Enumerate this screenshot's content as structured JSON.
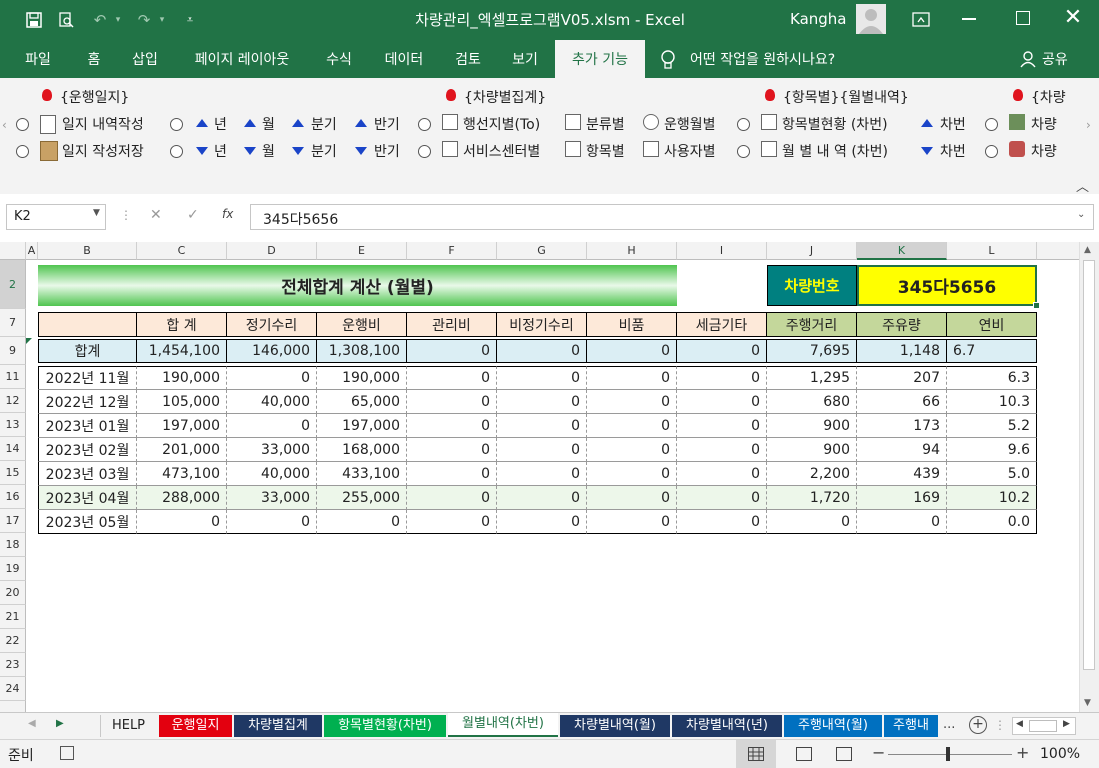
{
  "window": {
    "title": "차량관리_엑셀프로그램V05.xlsm  -  Excel",
    "user": "Kangha"
  },
  "ribbon_tabs": [
    "파일",
    "홈",
    "삽입",
    "페이지 레이아웃",
    "수식",
    "데이터",
    "검토",
    "보기",
    "추가 기능"
  ],
  "tell_me": "어떤 작업을 원하시나요?",
  "share_label": "공유",
  "ribbon": {
    "group1": {
      "title": "{운행일지}",
      "item1": "일지 내역작성",
      "item2": "일지 작성저장"
    },
    "period": {
      "year": "년",
      "month": "월",
      "quarter": "분기",
      "half": "반기"
    },
    "group2": {
      "title": "{차량별집계}",
      "a1": "행선지별(To)",
      "a2": "분류별",
      "a3": "운행월별",
      "b1": "서비스센터별",
      "b2": "항목별",
      "b3": "사용자별"
    },
    "group3": {
      "title": "{항목별}{월별내역}",
      "a1": "항목별현황 (차번)",
      "a2": "차번",
      "b1": "월 별 내 역 (차번)",
      "b2": "차번"
    },
    "group4": {
      "title": "{차량",
      "a1": "차량",
      "b1": "차량"
    }
  },
  "formula_bar": {
    "name_box": "K2",
    "fx": "fx",
    "value": "345다5656"
  },
  "columns": [
    "A",
    "B",
    "C",
    "D",
    "E",
    "F",
    "G",
    "H",
    "I",
    "J",
    "K",
    "L"
  ],
  "rows": [
    "2",
    "7",
    "9",
    "11",
    "12",
    "13",
    "14",
    "15",
    "16",
    "17",
    "18",
    "19",
    "20",
    "21",
    "22",
    "23",
    "24"
  ],
  "sheet": {
    "title": "전체합계 계산 (월별)",
    "vehicle_label": "차량번호",
    "vehicle_value": "345다5656",
    "headers": [
      "",
      "합  계",
      "정기수리",
      "운행비",
      "관리비",
      "비정기수리",
      "비품",
      "세금기타",
      "주행거리",
      "주유량",
      "연비"
    ],
    "total": [
      "합계",
      "1,454,100",
      "146,000",
      "1,308,100",
      "0",
      "0",
      "0",
      "0",
      "7,695",
      "1,148",
      "6.7"
    ],
    "data": [
      [
        "2022년 11월",
        "190,000",
        "0",
        "190,000",
        "0",
        "0",
        "0",
        "0",
        "1,295",
        "207",
        "6.3"
      ],
      [
        "2022년 12월",
        "105,000",
        "40,000",
        "65,000",
        "0",
        "0",
        "0",
        "0",
        "680",
        "66",
        "10.3"
      ],
      [
        "2023년 01월",
        "197,000",
        "0",
        "197,000",
        "0",
        "0",
        "0",
        "0",
        "900",
        "173",
        "5.2"
      ],
      [
        "2023년 02월",
        "201,000",
        "33,000",
        "168,000",
        "0",
        "0",
        "0",
        "0",
        "900",
        "94",
        "9.6"
      ],
      [
        "2023년 03월",
        "473,100",
        "40,000",
        "433,100",
        "0",
        "0",
        "0",
        "0",
        "2,200",
        "439",
        "5.0"
      ],
      [
        "2023년 04월",
        "288,000",
        "33,000",
        "255,000",
        "0",
        "0",
        "0",
        "0",
        "1,720",
        "169",
        "10.2"
      ],
      [
        "2023년 05월",
        "0",
        "0",
        "0",
        "0",
        "0",
        "0",
        "0",
        "0",
        "0",
        "0.0"
      ]
    ]
  },
  "sheet_tabs": [
    {
      "label": "HELP",
      "bg": "#f3f3f3",
      "fg": "#222"
    },
    {
      "label": "운행일지",
      "bg": "#e3000f",
      "fg": "#ffffff"
    },
    {
      "label": "차량별집계",
      "bg": "#1f3864",
      "fg": "#ffffff"
    },
    {
      "label": "항목별현황(차번)",
      "bg": "#00b050",
      "fg": "#ffffff"
    },
    {
      "label": "월별내역(차번)",
      "bg": "#ffffff",
      "fg": "#217346"
    },
    {
      "label": "차량별내역(월)",
      "bg": "#1f3864",
      "fg": "#ffffff"
    },
    {
      "label": "차량별내역(년)",
      "bg": "#1f3864",
      "fg": "#ffffff"
    },
    {
      "label": "주행내역(월)",
      "bg": "#0070c0",
      "fg": "#ffffff"
    },
    {
      "label": "주행내",
      "bg": "#0070c0",
      "fg": "#ffffff"
    }
  ],
  "status": {
    "ready": "준비",
    "zoom": "100%"
  },
  "colors": {
    "excel_green": "#217346",
    "header_fill": "#fde9d9",
    "data_col_fill": "#c4d79b",
    "total_fill": "#dbeef4",
    "vehicle_fill": "#ffff00",
    "vehicle_label_fill": "#008080"
  }
}
